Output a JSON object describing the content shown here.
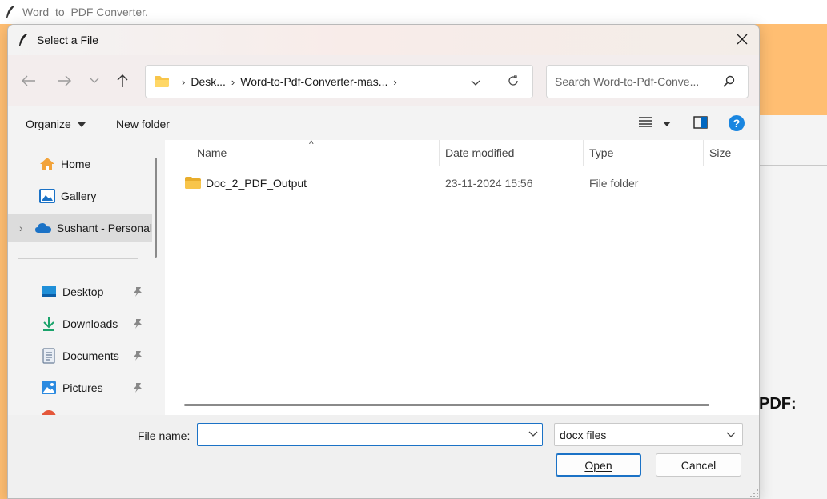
{
  "background_app": {
    "title": "Word_to_PDF Converter.",
    "partial_label": "PDF:",
    "colors": {
      "accent": "#ffbe72"
    }
  },
  "dialog": {
    "title": "Select a File",
    "breadcrumbs": [
      "Desk...",
      "Word-to-Pdf-Converter-mas..."
    ],
    "search_placeholder": "Search Word-to-Pdf-Conve...",
    "toolbar": {
      "organize_label": "Organize",
      "new_folder_label": "New folder"
    },
    "nav_pane": {
      "items": [
        {
          "label": "Home",
          "icon": "home-icon"
        },
        {
          "label": "Gallery",
          "icon": "gallery-icon"
        },
        {
          "label": "Sushant - Personal",
          "icon": "onedrive-cloud-icon",
          "selected": true
        },
        {
          "label": "Desktop",
          "icon": "desktop-icon"
        },
        {
          "label": "Downloads",
          "icon": "download-icon"
        },
        {
          "label": "Documents",
          "icon": "documents-icon"
        },
        {
          "label": "Pictures",
          "icon": "pictures-icon"
        }
      ]
    },
    "columns": [
      "Name",
      "Date modified",
      "Type",
      "Size"
    ],
    "files": [
      {
        "name": "Doc_2_PDF_Output",
        "date_modified": "23-11-2024 15:56",
        "type": "File folder",
        "size": ""
      }
    ],
    "file_name_label": "File name:",
    "file_name_value": "",
    "file_type": "docx files",
    "open_label": "Open",
    "cancel_label": "Cancel",
    "colors": {
      "accent_blue": "#1b72c6",
      "folder_yellow": "#f8c54a"
    }
  }
}
